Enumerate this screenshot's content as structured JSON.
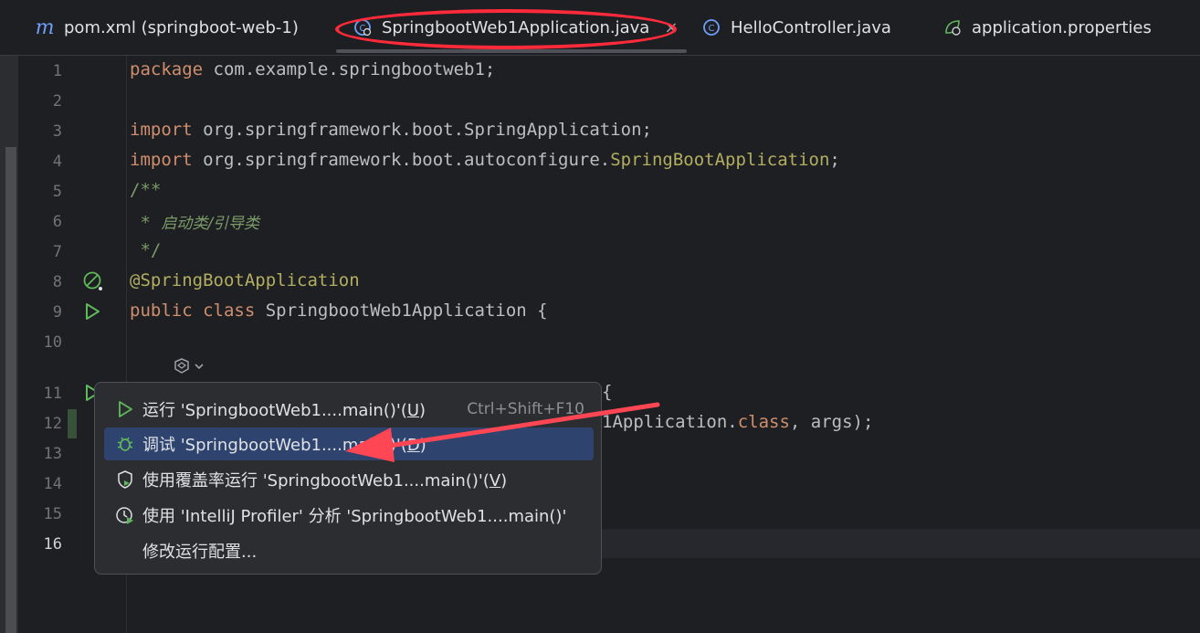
{
  "tabs": [
    {
      "label": "pom.xml (springboot-web-1)",
      "icon": "maven-m-icon",
      "active": false
    },
    {
      "label": "SpringbootWeb1Application.java",
      "icon": "java-class-icon",
      "active": true,
      "close": "×"
    },
    {
      "label": "HelloController.java",
      "icon": "java-class-icon",
      "active": false
    },
    {
      "label": "application.properties",
      "icon": "spring-properties-icon",
      "active": false
    }
  ],
  "editor": {
    "line_numbers": [
      "1",
      "2",
      "3",
      "4",
      "5",
      "6",
      "7",
      "8",
      "9",
      "10",
      "11",
      "12",
      "13",
      "14",
      "15",
      "16"
    ],
    "lines": {
      "l1_kw": "package",
      "l1_rest": " com.example.springbootweb1;",
      "l3_kw": "import",
      "l3_rest": " org.springframework.boot.SpringApplication;",
      "l4_kw": "import",
      "l4_rest": " org.springframework.boot.autoconfigure.",
      "l4_ann": "SpringBootApplication",
      "l4_end": ";",
      "l5": "/**",
      "l6_star": " * ",
      "l6_text": "启动类/引导类",
      "l7": " */",
      "l8": "@SpringBootApplication",
      "l9_kw1": "public",
      "l9_kw2": "class",
      "l9_rest": " SpringbootWeb1Application {",
      "l11_tail": "{",
      "l12_tail1": "1Application.",
      "l12_kw": "class",
      "l12_tail2": ", args);"
    }
  },
  "popup": {
    "items": [
      {
        "label_pre": "运行 'SpringbootWeb1....main()'(",
        "mnemonic": "U",
        "label_post": ")",
        "shortcut": "Ctrl+Shift+F10",
        "icon": "run-icon"
      },
      {
        "label_pre": "调试 'SpringbootWeb1....main()'(",
        "mnemonic": "D",
        "label_post": ")",
        "icon": "debug-icon"
      },
      {
        "label_pre": "使用覆盖率运行 'SpringbootWeb1....main()'(",
        "mnemonic": "V",
        "label_post": ")",
        "icon": "coverage-icon"
      },
      {
        "label_pre": "使用 'IntelliJ Profiler' 分析  'SpringbootWeb1....main()'",
        "mnemonic": "",
        "label_post": "",
        "icon": "profiler-icon"
      },
      {
        "label_pre": "修改运行配置...",
        "mnemonic": "",
        "label_post": "",
        "icon": ""
      }
    ]
  },
  "colors": {
    "annotation": "#ff2a3a",
    "selection": "#2e436e",
    "keyword": "#cf8e6d",
    "annotation_code": "#b3ae60",
    "comment": "#7a9b68"
  }
}
